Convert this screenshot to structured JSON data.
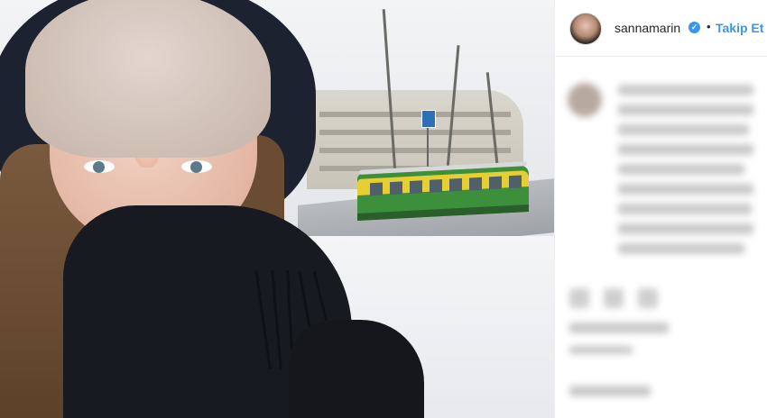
{
  "post": {
    "username": "sannamarin",
    "verified_mark": "✓",
    "separator": "•",
    "follow_label": "Takip Et"
  },
  "icons": {
    "verified": "verified-badge-icon",
    "avatar": "profile-avatar"
  },
  "colors": {
    "accent_blue": "#3897f0",
    "text": "#262626",
    "tram_green": "#3c8f3b",
    "tram_yellow": "#e6cf35"
  }
}
